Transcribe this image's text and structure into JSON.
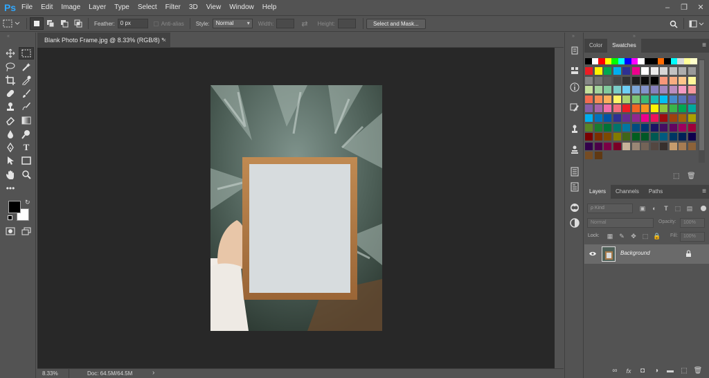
{
  "app": {
    "logo": "Ps"
  },
  "menu": [
    "File",
    "Edit",
    "Image",
    "Layer",
    "Type",
    "Select",
    "Filter",
    "3D",
    "View",
    "Window",
    "Help"
  ],
  "window_controls": {
    "minimize": "–",
    "restore": "❐",
    "close": "✕"
  },
  "options": {
    "feather_label": "Feather:",
    "feather_value": "0 px",
    "antialias_label": "Anti-alias",
    "style_label": "Style:",
    "style_value": "Normal",
    "width_label": "Width:",
    "height_label": "Height:",
    "select_mask_label": "Select and Mask..."
  },
  "document": {
    "tab_title": "Blank Photo Frame.jpg @ 8.33% (RGB/8) *",
    "close_glyph": "×"
  },
  "status": {
    "zoom": "8.33%",
    "doc": "Doc: 64.5M/64.5M",
    "arrow": "›"
  },
  "color_panel": {
    "tabs": [
      "Color",
      "Swatches"
    ],
    "active": "Swatches",
    "menu_glyph": "≡"
  },
  "swatch_colors": [
    [
      "#000000",
      "#ffffff",
      "#ff0000",
      "#ffff00",
      "#00ff00",
      "#00ffff",
      "#0000ff",
      "#ff00ff",
      "#ffffff",
      "#000000",
      "#000000",
      "#ff6a00",
      "#000000",
      "#00ffff",
      "#d9d9d9",
      "#ffff99",
      "#ffffcc"
    ],
    [
      "#ed1c24",
      "#fff200",
      "#00a651",
      "#00aeef",
      "#2e3192",
      "#ec008c",
      "#ffffff",
      "#ebebeb",
      "#d6d6d6",
      "#c2c2c2",
      "#adadad",
      "#999999"
    ],
    [
      "#858585",
      "#707070",
      "#5c5c5c",
      "#474747",
      "#333333",
      "#1f1f1f",
      "#0a0a0a",
      "#000000",
      "#f7977a",
      "#f9ad81",
      "#fdc68a",
      "#fff79a"
    ],
    [
      "#c4df9b",
      "#a3d39c",
      "#82ca9d",
      "#7bcdc8",
      "#6dcff6",
      "#7da7d9",
      "#8393ca",
      "#8781bd",
      "#a187be",
      "#bc8dbf",
      "#f49ac2",
      "#f6989d"
    ],
    [
      "#f26c4f",
      "#f68e55",
      "#fbaf5c",
      "#fff467",
      "#acd372",
      "#7cc576",
      "#3bb878",
      "#1abbb4",
      "#00bff3",
      "#438ccb",
      "#5574b9",
      "#605ca8"
    ],
    [
      "#855fa8",
      "#a763a8",
      "#f06eaa",
      "#f26d7d",
      "#ed1c24",
      "#f26522",
      "#f7941d",
      "#fff200",
      "#8dc63f",
      "#39b54a",
      "#00a651",
      "#00a99d"
    ],
    [
      "#00aeef",
      "#0072bc",
      "#0054a6",
      "#2e3192",
      "#662d91",
      "#92278f",
      "#ec008c",
      "#ed145b",
      "#9e0b0f",
      "#a0410d",
      "#a36209",
      "#aba000"
    ],
    [
      "#598527",
      "#197b30",
      "#007236",
      "#00746b",
      "#0076a3",
      "#004b80",
      "#003471",
      "#1b1464",
      "#440e62",
      "#630460",
      "#9e005d",
      "#9e0039"
    ],
    [
      "#790000",
      "#7b2e00",
      "#7d4900",
      "#827b00",
      "#406618",
      "#005e20",
      "#005826",
      "#005952",
      "#005b7f",
      "#003663",
      "#002157",
      "#0d004c"
    ],
    [
      "#32004b",
      "#4b0049",
      "#7b0046",
      "#7a0026",
      "#c7b299",
      "#998675",
      "#736357",
      "#534741",
      "#37302d",
      "#c69c6d",
      "#a67c52",
      "#8c6239"
    ],
    [
      "#754c24",
      "#603913"
    ]
  ],
  "layers_panel": {
    "tabs": [
      "Layers",
      "Channels",
      "Paths"
    ],
    "active": "Layers",
    "menu_glyph": "≡",
    "kind_label": "ρ Kind",
    "blend_value": "Normal",
    "opacity_label": "Opacity:",
    "opacity_value": "100%",
    "lock_label": "Lock:",
    "fill_label": "Fill:",
    "fill_value": "100%",
    "layer_name": "Background",
    "footer_icons": [
      "∞",
      "fx",
      "◘",
      "◑",
      "▬",
      "⬚",
      "🗑"
    ]
  }
}
